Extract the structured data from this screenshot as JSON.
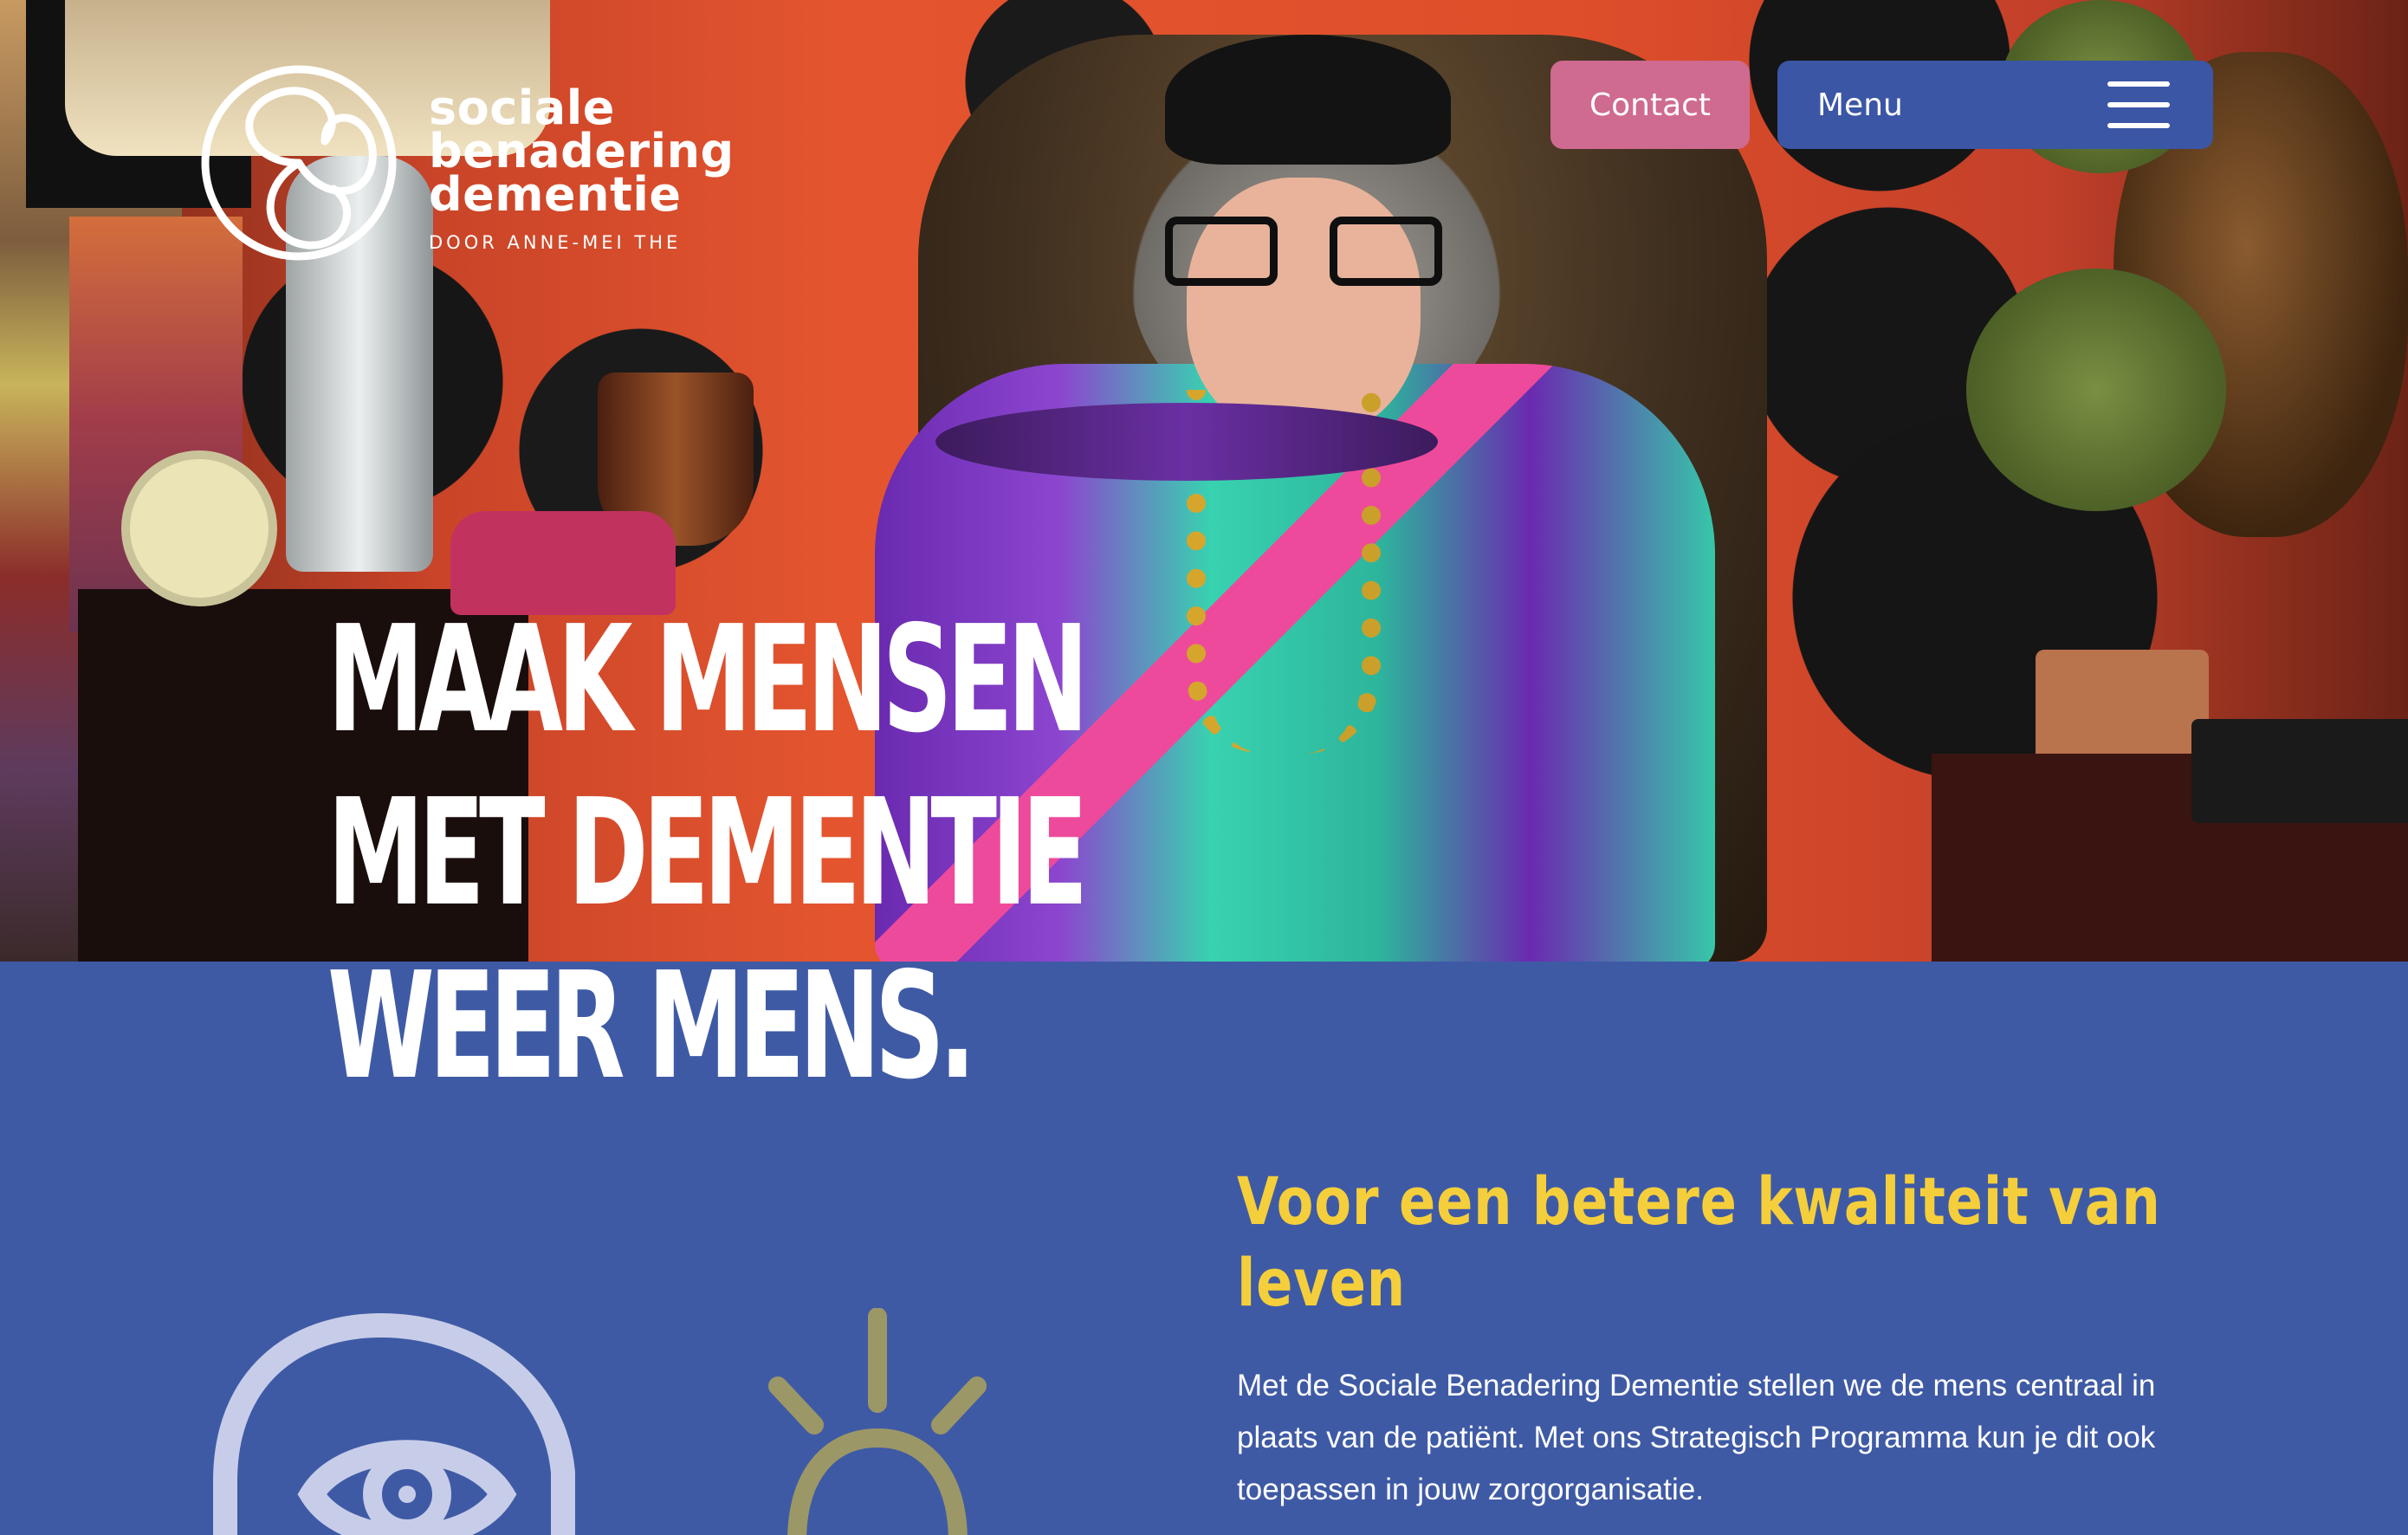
{
  "brand": {
    "logo_lines": [
      "sociale",
      "benadering",
      "dementie"
    ],
    "byline": "DOOR ANNE-MEI THE"
  },
  "nav": {
    "contact_label": "Contact",
    "menu_label": "Menu"
  },
  "hero": {
    "headline_lines": [
      "MAAK MENSEN",
      "MET DEMENTIE",
      "WEER MENS."
    ]
  },
  "intro": {
    "subtitle": "Voor een betere kwaliteit van leven",
    "body": "Met de Sociale Benadering Dementie stellen we de mens centraal in plaats van de patiënt. Met ons Strategisch Programma kun je dit ook toepassen in jouw zorgorganisatie."
  },
  "colors": {
    "section_blue": "#3f5aa5",
    "contact_pink": "#cf6a90",
    "menu_blue": "#3b56a5",
    "subtitle_yellow": "#f5cf3b",
    "illustration_lavender": "#c7cde8",
    "illustration_olive": "#9c9766"
  },
  "icons": {
    "logo_mark": "triskele-logo-icon",
    "menu": "hamburger-menu-icon",
    "illustration_1": "head-with-eye-icon",
    "illustration_2": "sun-icon"
  }
}
